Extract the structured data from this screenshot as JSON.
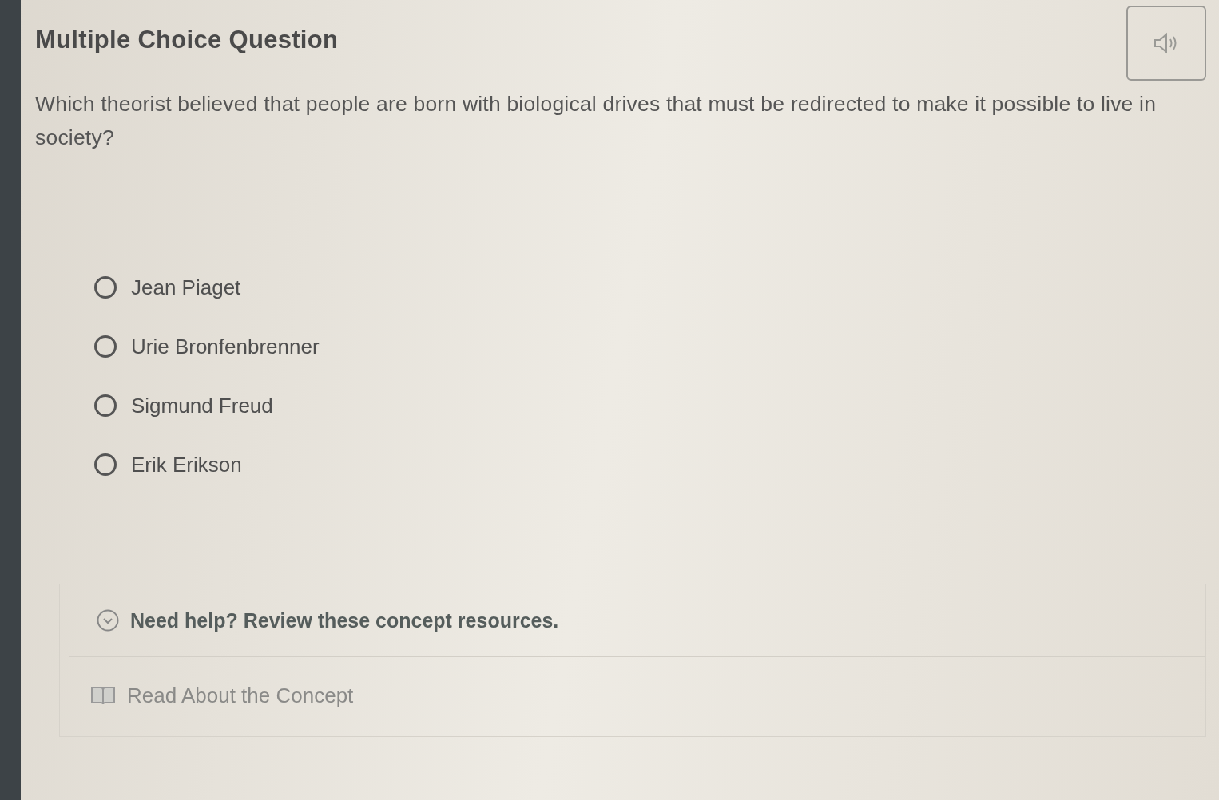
{
  "title": "Multiple Choice Question",
  "question": "Which theorist believed that people are born with biological drives that must be redirected to make it possible to live in society?",
  "options": [
    {
      "label": "Jean Piaget",
      "selected": false
    },
    {
      "label": "Urie Bronfenbrenner",
      "selected": false
    },
    {
      "label": "Sigmund Freud",
      "selected": false
    },
    {
      "label": "Erik Erikson",
      "selected": false
    }
  ],
  "help": {
    "heading": "Need help? Review these concept resources.",
    "link": "Read About the Concept"
  }
}
